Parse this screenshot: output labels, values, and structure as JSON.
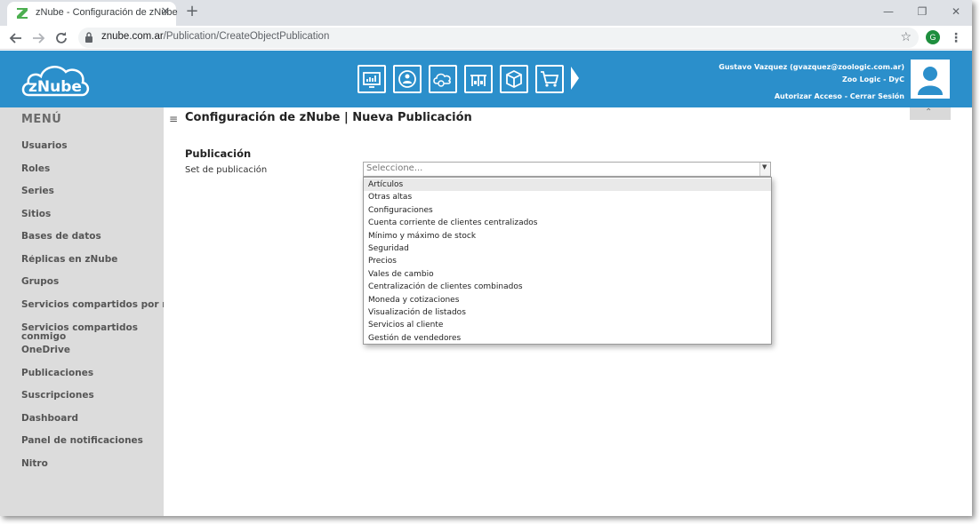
{
  "browser": {
    "tab_title": "zNube - Configuración de zNube",
    "tab_close": "✕",
    "new_tab": "+",
    "url_host": "znube.com.ar",
    "url_path": "/Publication/CreateObjectPublication",
    "profile_initial": "G",
    "window_controls": {
      "minimize": "—",
      "restore": "❐",
      "close": "✕"
    }
  },
  "header": {
    "logo_text": "zNube",
    "user_line": "Gustavo Vazquez (gvazquez@zoologic.com.ar)",
    "company_line": "Zoo Logic - DyC",
    "auth_link": "Autorizar Acceso",
    "separator": " - ",
    "logout_link": "Cerrar Sesión",
    "module_icons": [
      "dashboard-icon",
      "users-network-icon",
      "cloud-settings-icon",
      "warehouse-icon",
      "box-icon",
      "shopping-cart-icon"
    ],
    "accent": "#2b8fcb"
  },
  "sidebar": {
    "title": "MENÚ",
    "items": [
      {
        "label": "Usuarios"
      },
      {
        "label": "Roles"
      },
      {
        "label": "Series"
      },
      {
        "label": "Sitios"
      },
      {
        "label": "Bases de datos"
      },
      {
        "label": "Réplicas en zNube"
      },
      {
        "label": "Grupos"
      },
      {
        "label": "Servicios compartidos por mí"
      },
      {
        "label": "Servicios compartidos conmigo"
      },
      {
        "label": "OneDrive"
      },
      {
        "label": "Publicaciones"
      },
      {
        "label": "Suscripciones"
      },
      {
        "label": "Dashboard"
      },
      {
        "label": "Panel de notificaciones"
      },
      {
        "label": "Nitro"
      }
    ]
  },
  "main": {
    "page_title": "Configuración de zNube | Nueva Publicación",
    "section_title": "Publicación",
    "field_label": "Set de publicación",
    "select_placeholder": "Seleccione...",
    "options": [
      "Artículos",
      "Otras altas",
      "Configuraciones",
      "Cuenta corriente de clientes centralizados",
      "Mínimo y máximo de stock",
      "Seguridad",
      "Precios",
      "Vales de cambio",
      "Centralización de clientes combinados",
      "Moneda y cotizaciones",
      "Visualización de listados",
      "Servicios al cliente",
      "Gestión de vendedores"
    ],
    "highlighted_option": "Artículos"
  }
}
